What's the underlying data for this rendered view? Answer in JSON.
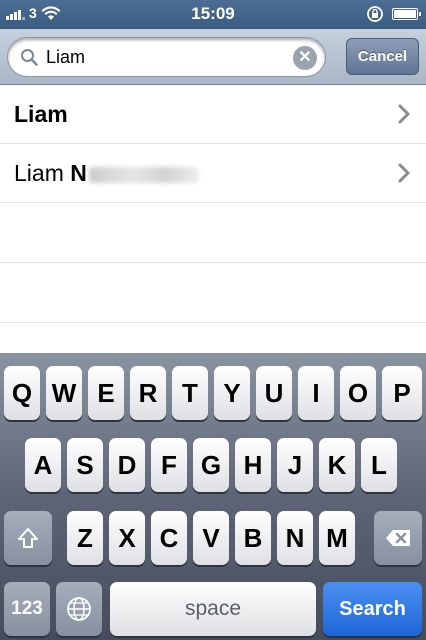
{
  "status_bar": {
    "carrier": "3",
    "time": "15:09"
  },
  "search": {
    "query": "Liam",
    "cancel_label": "Cancel"
  },
  "results": [
    {
      "label": "Liam"
    },
    {
      "first": "Liam",
      "last_initial": "N"
    }
  ],
  "keyboard": {
    "row1": [
      "Q",
      "W",
      "E",
      "R",
      "T",
      "Y",
      "U",
      "I",
      "O",
      "P"
    ],
    "row2": [
      "A",
      "S",
      "D",
      "F",
      "G",
      "H",
      "J",
      "K",
      "L"
    ],
    "row3": [
      "Z",
      "X",
      "C",
      "V",
      "B",
      "N",
      "M"
    ],
    "numbers_label": "123",
    "space_label": "space",
    "search_label": "Search"
  },
  "colors": {
    "status_bar": "#3f6088",
    "search_key": "#2a72e0"
  }
}
